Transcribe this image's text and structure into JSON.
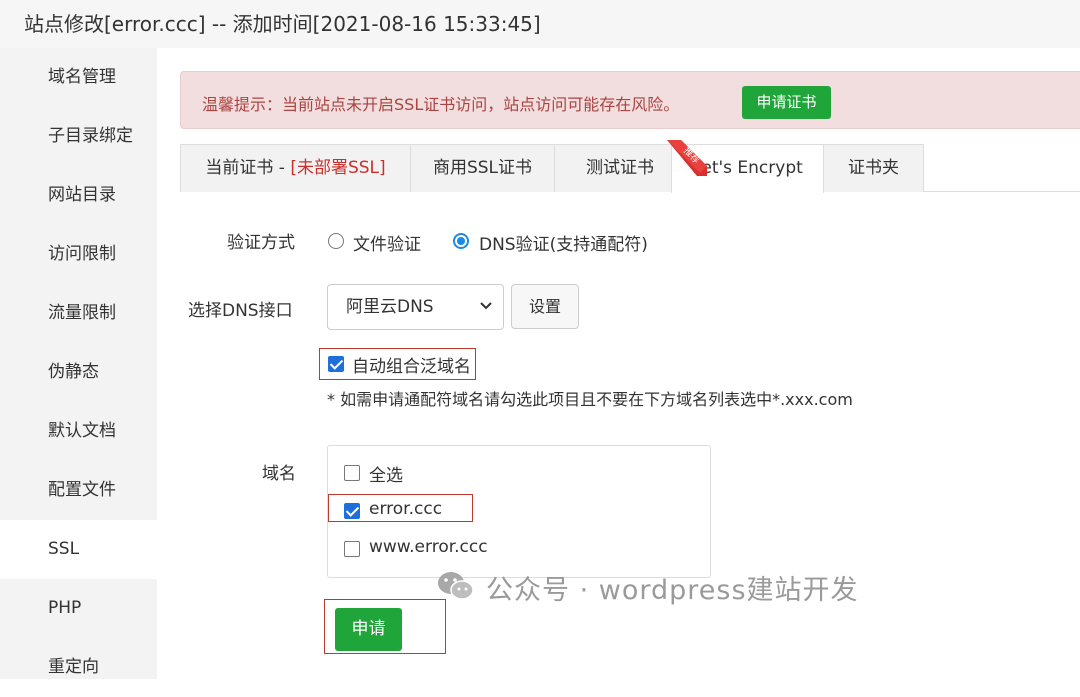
{
  "title": "站点修改[error.ccc] -- 添加时间[2021-08-16 15:33:45]",
  "sidebar": {
    "items": [
      {
        "label": "域名管理"
      },
      {
        "label": "子目录绑定"
      },
      {
        "label": "网站目录"
      },
      {
        "label": "访问限制"
      },
      {
        "label": "流量限制"
      },
      {
        "label": "伪静态"
      },
      {
        "label": "默认文档"
      },
      {
        "label": "配置文件"
      },
      {
        "label": "SSL"
      },
      {
        "label": "PHP"
      },
      {
        "label": "重定向"
      }
    ],
    "active": "SSL"
  },
  "alert": {
    "text": "温馨提示：当前站点未开启SSL证书访问，站点访问可能存在风险。",
    "button": "申请证书"
  },
  "tabs": {
    "current_cert_prefix": "当前证书 - ",
    "current_cert_status": "[未部署SSL]",
    "commercial": "商用SSL证书",
    "ribbon": "推荐",
    "test": "测试证书",
    "letsencrypt": "Let's Encrypt",
    "folder": "证书夹",
    "active": "Let's Encrypt"
  },
  "form": {
    "verify_label": "验证方式",
    "verify_file": "文件验证",
    "verify_dns": "DNS验证(支持通配符)",
    "verify_selected": "DNS验证(支持通配符)",
    "dns_label": "选择DNS接口",
    "dns_value": "阿里云DNS",
    "settings_button": "设置",
    "auto_wildcard": "自动组合泛域名",
    "auto_wildcard_checked": true,
    "hint": "* 如需申请通配符域名请勾选此项目且不要在下方域名列表选中*.xxx.com",
    "domain_label": "域名",
    "domains": [
      {
        "name": "全选",
        "checked": false
      },
      {
        "name": "error.ccc",
        "checked": true
      },
      {
        "name": "www.error.ccc",
        "checked": false
      }
    ],
    "submit": "申请"
  },
  "watermark": "公众号 · wordpress建站开发",
  "colors": {
    "accent_green": "#20a53a",
    "alert_bg": "#f2dede",
    "alert_text": "#a94442",
    "highlight_red": "#c0392b",
    "check_blue": "#1e6fd9"
  }
}
